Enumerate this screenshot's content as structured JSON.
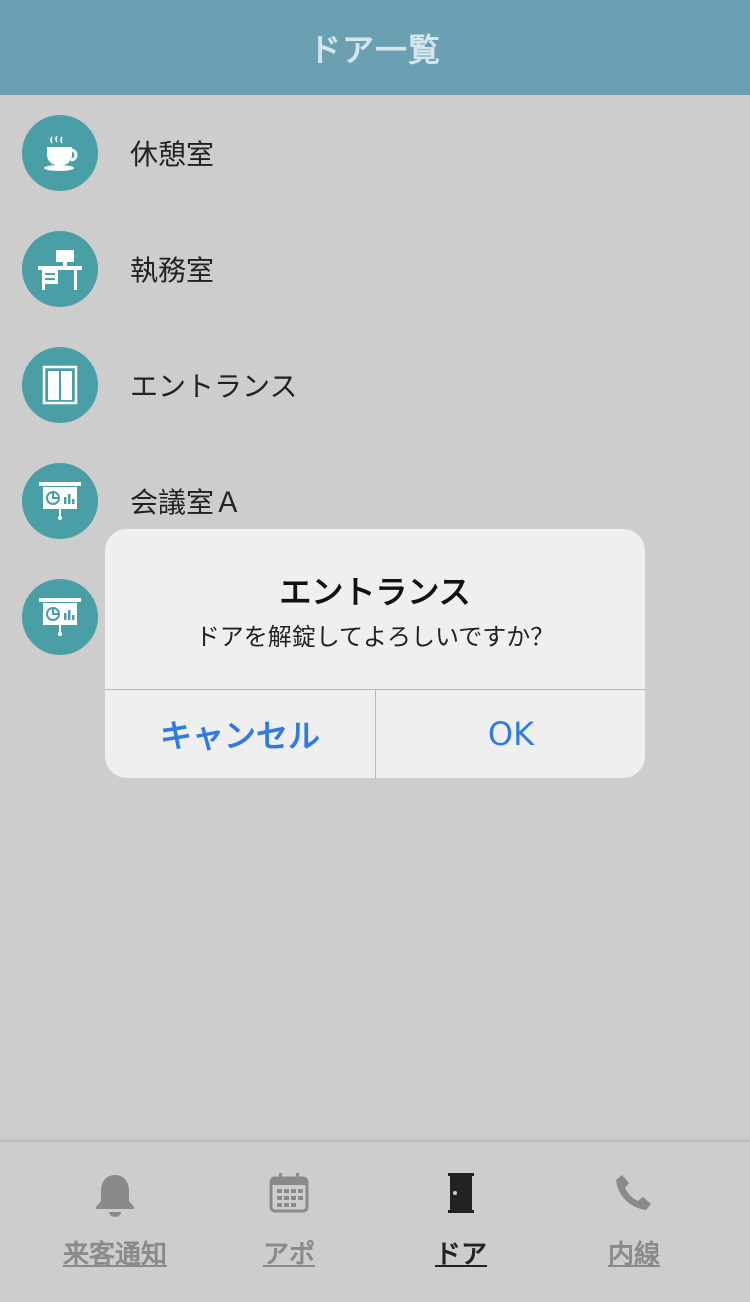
{
  "header": {
    "title": "ドア一覧"
  },
  "rooms": [
    {
      "label": "休憩室",
      "icon": "coffee-cup-icon"
    },
    {
      "label": "執務室",
      "icon": "office-desk-icon"
    },
    {
      "label": "エントランス",
      "icon": "door-icon"
    },
    {
      "label": "会議室Ａ",
      "icon": "presentation-board-icon"
    },
    {
      "label": "",
      "icon": "presentation-board-icon"
    }
  ],
  "dialog": {
    "title": "エントランス",
    "message": "ドアを解錠してよろしいですか？",
    "cancel_label": "キャンセル",
    "ok_label": "OK"
  },
  "tabs": [
    {
      "label": "来客通知",
      "icon": "bell-icon"
    },
    {
      "label": "アポ",
      "icon": "calendar-icon"
    },
    {
      "label": "ドア",
      "icon": "door-icon",
      "active": true
    },
    {
      "label": "内線",
      "icon": "phone-icon"
    }
  ],
  "colors": {
    "header": "#6aa0b2",
    "icon_circle": "#4a9ea6",
    "accent_blue": "#2f7be0",
    "background": "#cdcdcd"
  }
}
